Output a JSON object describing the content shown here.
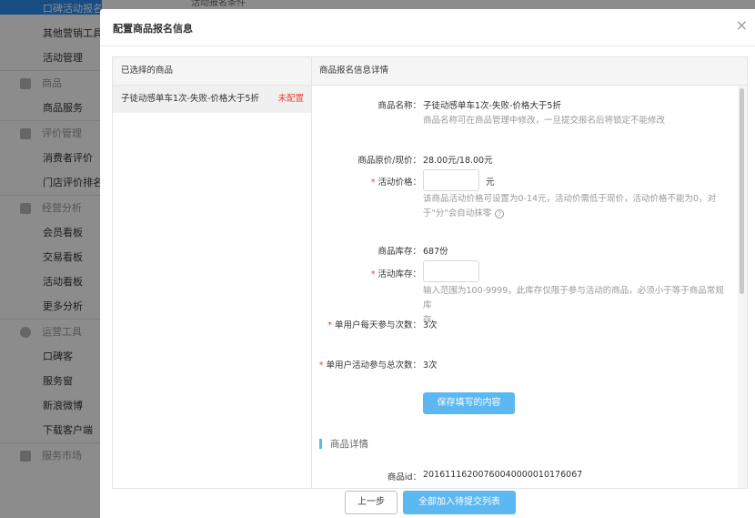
{
  "sidebar": {
    "active_item": "口碑活动报名",
    "items_top": [
      "其他营销工具",
      "活动管理"
    ],
    "groups": [
      {
        "title": "商品",
        "icon": "box-icon",
        "items": [
          "商品服务"
        ]
      },
      {
        "title": "评价管理",
        "icon": "checkbox-icon",
        "items": [
          "消费者评价",
          "门店评价排名"
        ]
      },
      {
        "title": "经营分析",
        "icon": "chart-icon",
        "items": [
          "会员看板",
          "交易看板",
          "活动看板",
          "更多分析"
        ]
      },
      {
        "title": "运营工具",
        "icon": "exclamation-circle-icon",
        "items": [
          "口碑客",
          "服务窗",
          "新浪微博",
          "下载客户端"
        ]
      },
      {
        "title": "服务市场",
        "icon": "store-icon",
        "items": []
      }
    ]
  },
  "background": {
    "subheader": "活动报名条件"
  },
  "modal": {
    "title": "配置商品报名信息",
    "close_icon": "×",
    "left_header": "已选择的商品",
    "right_header": "商品报名信息详情",
    "selected_product": {
      "name": "子徒动感单车1次-失败-价格大于5折",
      "status": "未配置"
    },
    "form": {
      "name_label": "商品名称：",
      "name_value": "子徒动感单车1次-失败-价格大于5折",
      "name_hint": "商品名称可在商品管理中修改，一旦提交报名后将锁定不能修改",
      "price_label": "商品原价/现价：",
      "price_value": "28.00元/18.00元",
      "activity_price_label": "活动价格：",
      "activity_price_unit": "元",
      "activity_price_hint_1": "该商品活动价格可设置为0-14元，活动价需低于现价，活动价格不能为0，对",
      "activity_price_hint_2": "于\"分\"会自动抹零",
      "stock_label": "商品库存：",
      "stock_value": "687份",
      "activity_stock_label": "活动库存：",
      "activity_stock_hint_1": "输入范围为100-9999，此库存仅限于参与活动的商品，必须小于等于商品常规库",
      "activity_stock_hint_2": "存",
      "daily_limit_label": "单用户每天参与次数：",
      "daily_limit_value": "3次",
      "total_limit_label": "单用户活动参与总次数：",
      "total_limit_value": "3次",
      "save_button": "保存填写的内容",
      "section_title": "商品详情",
      "product_id_label": "商品id：",
      "product_id_value": "20161116200760040000010176067"
    },
    "footer": {
      "prev_button": "上一步",
      "submit_button": "全部加入待提交列表"
    }
  },
  "colors": {
    "accent": "#5bb8f0",
    "error": "#f04134",
    "active_nav": "#2d8cf0"
  }
}
